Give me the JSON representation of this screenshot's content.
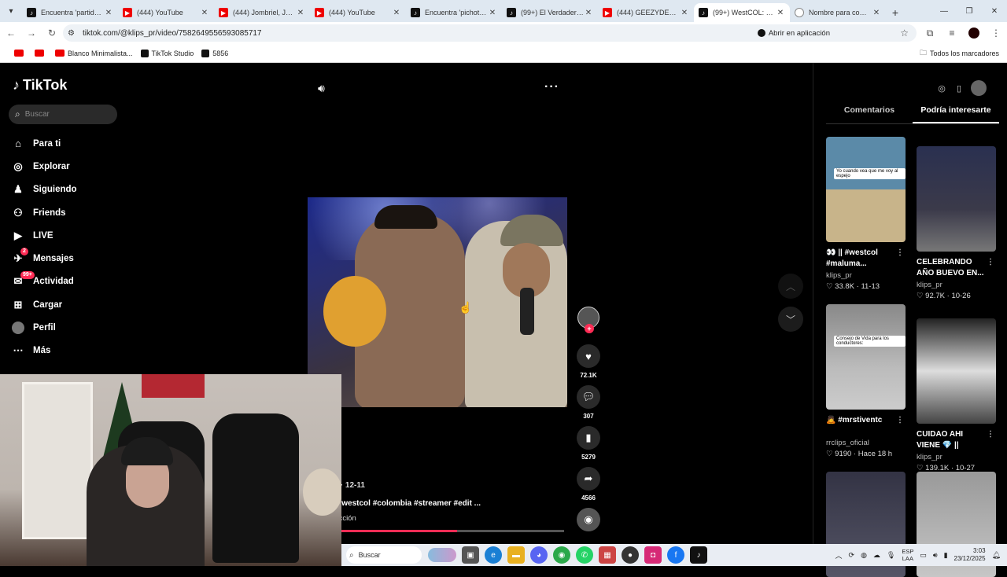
{
  "browser": {
    "tabs": [
      {
        "title": "Encuentra 'partido co",
        "icon": "tiktok",
        "active": false
      },
      {
        "title": "(444) YouTube",
        "icon": "youtube",
        "active": false
      },
      {
        "title": "(444) Jombriel, Jøtta",
        "icon": "youtube",
        "active": false
      },
      {
        "title": "(444) YouTube",
        "icon": "youtube",
        "active": false
      },
      {
        "title": "Encuentra 'pichota w",
        "icon": "tiktok",
        "active": false
      },
      {
        "title": "(99+) El Verdadero Te",
        "icon": "tiktok",
        "active": false
      },
      {
        "title": "(444) GEEZYDEE - VA",
        "icon": "youtube",
        "active": false
      },
      {
        "title": "(99+) WestCOL: El Gr",
        "icon": "tiktok",
        "active": true
      },
      {
        "title": "Nombre para comun",
        "icon": "globe",
        "active": false
      }
    ],
    "url": "tiktok.com/@klips_pr/video/7582649556593085717",
    "open_in_app": "Abrir en aplicación",
    "bookmarks": [
      {
        "label": "",
        "icon": "youtube"
      },
      {
        "label": "",
        "icon": "youtube"
      },
      {
        "label": "Blanco Minimalista...",
        "icon": "youtube"
      },
      {
        "label": "TikTok Studio",
        "icon": "tiktok"
      },
      {
        "label": "5856",
        "icon": "tiktok"
      }
    ],
    "all_bookmarks": "Todos los marcadores"
  },
  "tiktok": {
    "logo": "TikTok",
    "search_placeholder": "Buscar",
    "nav": [
      {
        "label": "Para ti",
        "icon": "home-icon"
      },
      {
        "label": "Explorar",
        "icon": "compass-icon"
      },
      {
        "label": "Siguiendo",
        "icon": "following-icon"
      },
      {
        "label": "Friends",
        "icon": "friends-icon"
      },
      {
        "label": "LIVE",
        "icon": "live-icon"
      },
      {
        "label": "Mensajes",
        "icon": "messages-icon",
        "badge": "2"
      },
      {
        "label": "Actividad",
        "icon": "activity-icon",
        "badge": "99+"
      },
      {
        "label": "Cargar",
        "icon": "upload-icon"
      },
      {
        "label": "Perfil",
        "icon": "profile-icon"
      },
      {
        "label": "Más",
        "icon": "more-icon"
      }
    ],
    "video": {
      "author_line": "or · 12-11",
      "description": "L #westcol #colombia #streamer #edit ...",
      "music": "ducción",
      "progress": 0.52
    },
    "actions": {
      "likes": "72.1K",
      "comments": "307",
      "saves": "5279",
      "shares": "4566"
    },
    "right_panel": {
      "tabs": [
        "Comentarios",
        "Podría interesarte"
      ],
      "active_tab": 1,
      "cards": [
        {
          "title": "👀 || #westcol #maluma...",
          "user": "klips_pr",
          "likes": "33.8K",
          "date": "11-13",
          "thumb": "th-a",
          "caption": "Yo cuando vea que me voy al espejo"
        },
        {
          "title": "CELEBRANDO AÑO BUEVO EN...",
          "user": "klips_pr",
          "likes": "92.7K",
          "date": "10-26",
          "thumb": "th-b",
          "caption": ""
        },
        {
          "title": "🙇 #mrstiventc",
          "user": "rrclips_oficial",
          "likes": "9190",
          "date": "Hace 18 h",
          "thumb": "th-c",
          "caption": "Consejo de Vida para los conductores:"
        },
        {
          "title": "CUIDAO AHI VIENE 💎 || #westcol",
          "user": "klips_pr",
          "likes": "139.1K",
          "date": "10-27",
          "thumb": "th-d",
          "caption": ""
        },
        {
          "title": "",
          "user": "",
          "likes": "",
          "date": "",
          "thumb": "th-e",
          "caption": ""
        },
        {
          "title": "",
          "user": "",
          "likes": "",
          "date": "",
          "thumb": "th-f",
          "caption": ""
        }
      ]
    }
  },
  "taskbar": {
    "search": "Buscar",
    "lang_top": "ESP",
    "lang_bottom": "LAA",
    "time": "3:03",
    "date": "23/12/2025"
  }
}
